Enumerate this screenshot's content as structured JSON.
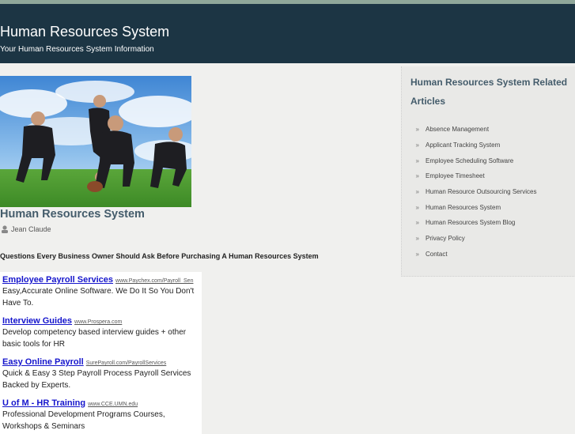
{
  "header": {
    "title": "Human Resources System",
    "tagline": "Your Human Resources System Information"
  },
  "post": {
    "title": "Human Resources System",
    "author": "Jean Claude",
    "author_icon": "user-icon",
    "headline": "Questions Every Business Owner Should Ask Before Purchasing A Human Resources System"
  },
  "ads": [
    {
      "title": "Employee Payroll Services",
      "url": "www.Paychex.com/Payroll_Sen",
      "desc": "Easy,Accurate Online Software. We Do It So You Don't Have To."
    },
    {
      "title": "Interview Guides",
      "url": "www.Prospera.com",
      "desc": "Develop competency based interview guides + other basic tools for HR"
    },
    {
      "title": "Easy Online Payroll",
      "url": "SurePayroll.com/PayrollServices",
      "desc": "Quick & Easy 3 Step Payroll Process Payroll Services Backed by Experts."
    },
    {
      "title": "U of M - HR Training",
      "url": "www.CCE.UMN.edu",
      "desc": "Professional Development Programs Courses, Workshops & Seminars"
    }
  ],
  "sidebar": {
    "title": "Human Resources System Related Articles",
    "bullet": "»",
    "items": [
      {
        "label": "Absence Management"
      },
      {
        "label": "Applicant Tracking System"
      },
      {
        "label": "Employee Scheduling Software"
      },
      {
        "label": "Employee Timesheet"
      },
      {
        "label": "Human Resource Outsourcing Services"
      },
      {
        "label": "Human Resources System"
      },
      {
        "label": "Human Resources System Blog"
      },
      {
        "label": "Privacy Policy"
      },
      {
        "label": "Contact"
      }
    ]
  },
  "colors": {
    "header_bg": "#1c3544",
    "accent": "#445c6b",
    "ad_link": "#1515cc"
  }
}
